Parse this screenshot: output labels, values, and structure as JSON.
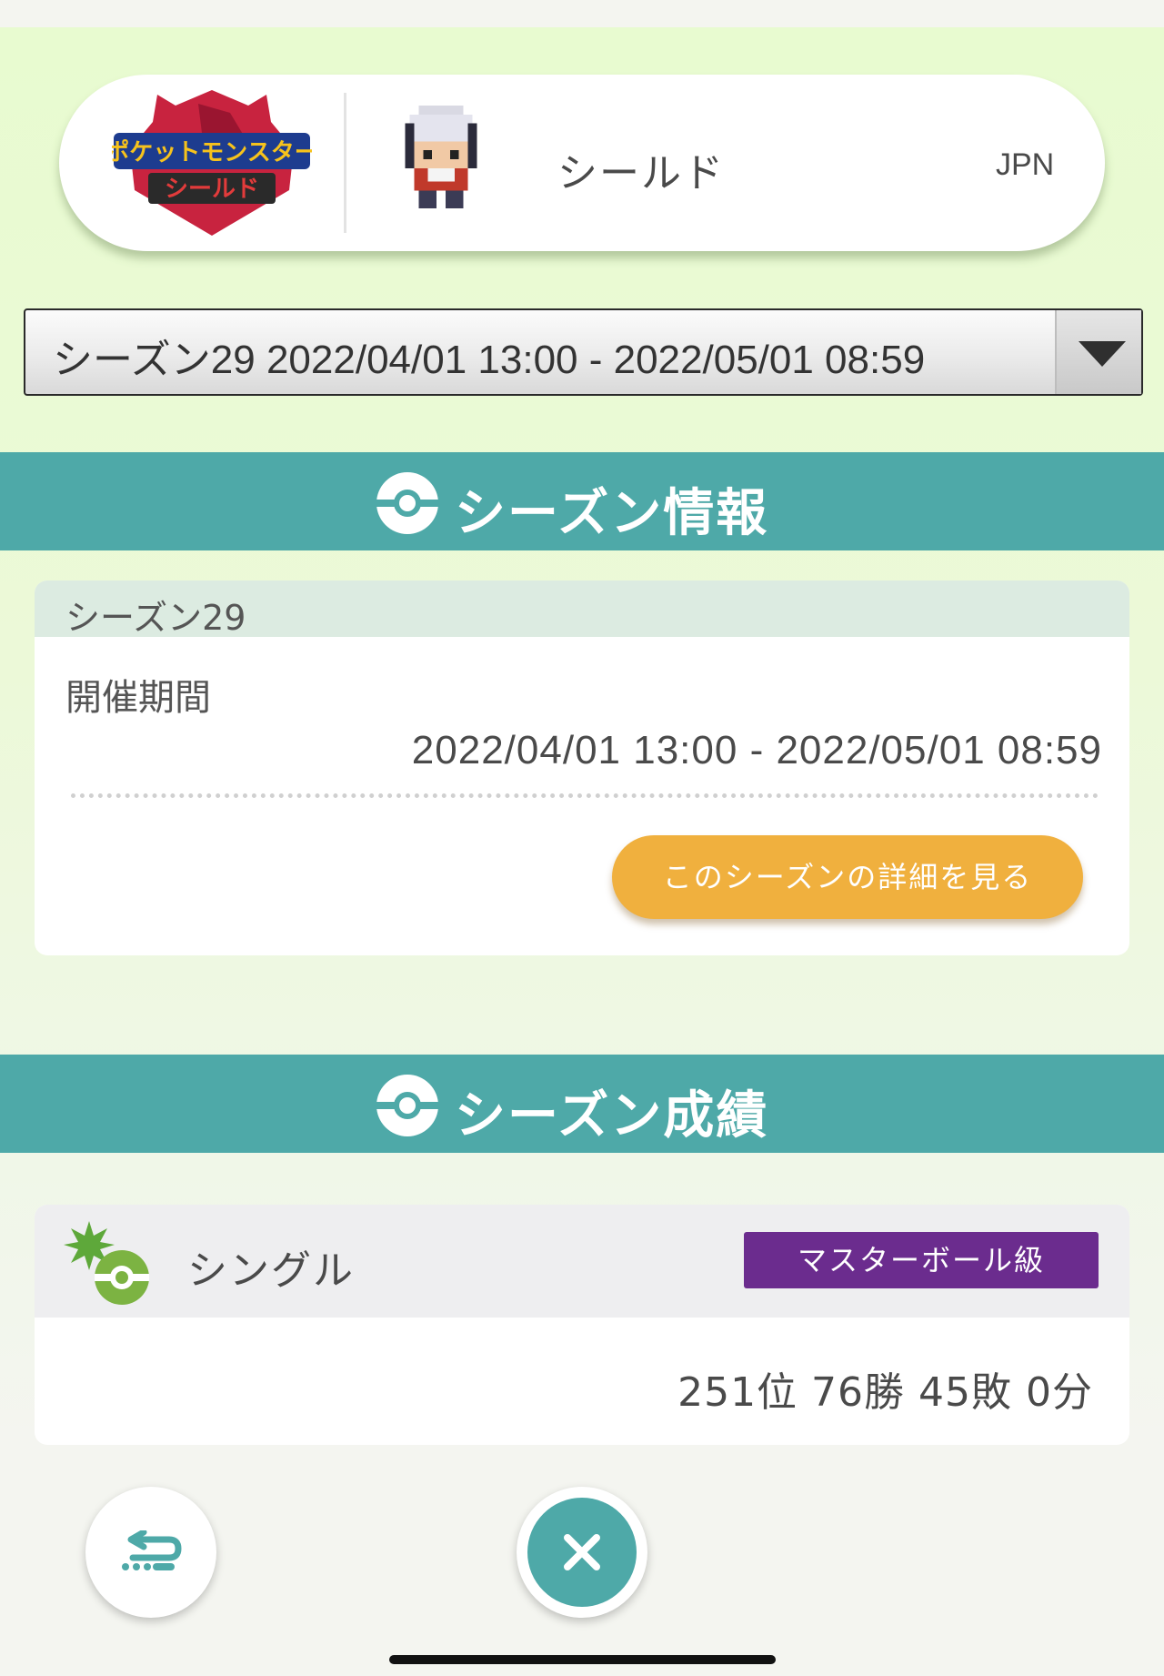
{
  "profile": {
    "logo_text_top": "ポケットモンスター",
    "logo_text_bottom": "シールド",
    "game_name": "シールド",
    "region": "JPN"
  },
  "season_select": {
    "selected_label": "シーズン29 2022/04/01 13:00 - 2022/05/01 08:59"
  },
  "season_info": {
    "header_title": "シーズン情報",
    "season_name": "シーズン29",
    "period_label": "開催期間",
    "period_value": "2022/04/01 13:00 - 2022/05/01 08:59",
    "detail_button_label": "このシーズンの詳細を見る"
  },
  "season_results": {
    "header_title": "シーズン成績",
    "battle_type": "シングル",
    "rank_badge": "マスターボール級",
    "stats": "251位 76勝 45敗 0分"
  },
  "colors": {
    "teal": "#4ea9a8",
    "orange_button": "#f0b03e",
    "master_ball_purple": "#6b2c8e",
    "logo_red": "#c8233f",
    "icon_green": "#7cb342"
  },
  "icons": {
    "section_icon": "pokeball-icon",
    "back": "back-arrow-icon",
    "close": "close-icon"
  }
}
